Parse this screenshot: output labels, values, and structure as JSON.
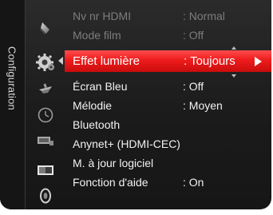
{
  "side_tab": {
    "label": "Configuration"
  },
  "icons": [
    "picture-icon",
    "setup-icon",
    "satellite-icon",
    "clock-icon",
    "input-icon",
    "application-icon",
    "support-icon"
  ],
  "menu": {
    "items": [
      {
        "label": "Nv nr HDMI",
        "value": ": Normal",
        "state": "disabled"
      },
      {
        "label": "Mode film",
        "value": ": Off",
        "state": "disabled"
      },
      {
        "label": "Effet lumière",
        "value": ": Toujours",
        "state": "selected"
      },
      {
        "label": "Écran Bleu",
        "value": ": Off",
        "state": "normal"
      },
      {
        "label": "Mélodie",
        "value": ": Moyen",
        "state": "normal"
      },
      {
        "label": "Bluetooth",
        "value": "",
        "state": "normal"
      },
      {
        "label": "Anynet+ (HDMI-CEC)",
        "value": "",
        "state": "normal"
      },
      {
        "label": "M. à jour logiciel",
        "value": "",
        "state": "normal"
      },
      {
        "label": "Fonction d'aide",
        "value": ": On",
        "state": "normal"
      }
    ]
  },
  "colors": {
    "panel_bg": "#1b1b1b",
    "highlight": "#ee1c1c",
    "text": "#f2f2f2",
    "disabled_text": "#7d7d7d"
  }
}
